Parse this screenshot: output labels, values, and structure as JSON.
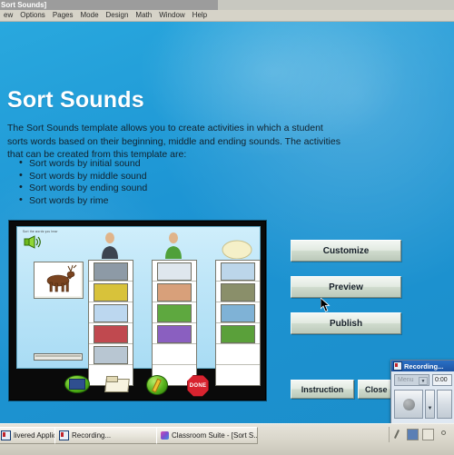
{
  "window": {
    "title": "Sort Sounds]",
    "menu": [
      "ew",
      "Options",
      "Pages",
      "Mode",
      "Design",
      "Math",
      "Window",
      "Help"
    ]
  },
  "page": {
    "title": "Sort Sounds",
    "intro": "The Sort Sounds template allows you to create activities in which a student sorts words based on their beginning, middle and ending sounds.  The activities that can be created from this template are:",
    "bullets": [
      "Sort words by initial sound",
      "Sort words by middle sound",
      "Sort words by ending sound",
      "Sort words by rime"
    ]
  },
  "preview": {
    "tiny_label": "Sort the words you hear",
    "speaker_icon": "speaker-icon",
    "toolbar_icons": [
      "screen-icon",
      "folder-icon",
      "compass-icon",
      "done-stop-icon"
    ],
    "done_label": "DONE",
    "columns": [
      {
        "head_icon": "man-photo",
        "cells": [
          "mouse-picture",
          "tie-picture",
          "kite-picture",
          "mug-picture",
          "mop-picture",
          ""
        ]
      },
      {
        "head_icon": "girl-photo",
        "cells": [
          "jug-picture",
          "girl-eating-picture",
          "boy-picture",
          "cart-picture",
          "",
          ""
        ]
      },
      {
        "head_icon": "egg-photo",
        "cells": [
          "boat-picture",
          "hill-picture",
          "lake-picture",
          "doll-picture",
          "",
          ""
        ]
      }
    ],
    "word_card": "elk-picture"
  },
  "buttons": {
    "customize": "Customize",
    "preview": "Preview",
    "publish": "Publish",
    "instruction": "Instruction",
    "close": "Close"
  },
  "recorder": {
    "title": "Recording...",
    "menu_label": "Menu",
    "timer": "0:00",
    "record_icon": "record-button-icon",
    "dropdown_icon": "chevron-down-icon"
  },
  "taskbar": {
    "items": [
      {
        "label": "livered Applicati...",
        "icon": "app-icon"
      },
      {
        "label": "Recording...",
        "icon": "recorder-icon"
      },
      {
        "label": "Classroom Suite - [Sort S...",
        "icon": "classroom-suite-icon"
      }
    ],
    "tray_icons": [
      "pen-icon",
      "network-icon",
      "help-icon",
      "volume-icon"
    ]
  },
  "colors": {
    "background_blue": "#1d95d4",
    "title_white": "#ffffff",
    "accent_red": "#d8232f"
  }
}
